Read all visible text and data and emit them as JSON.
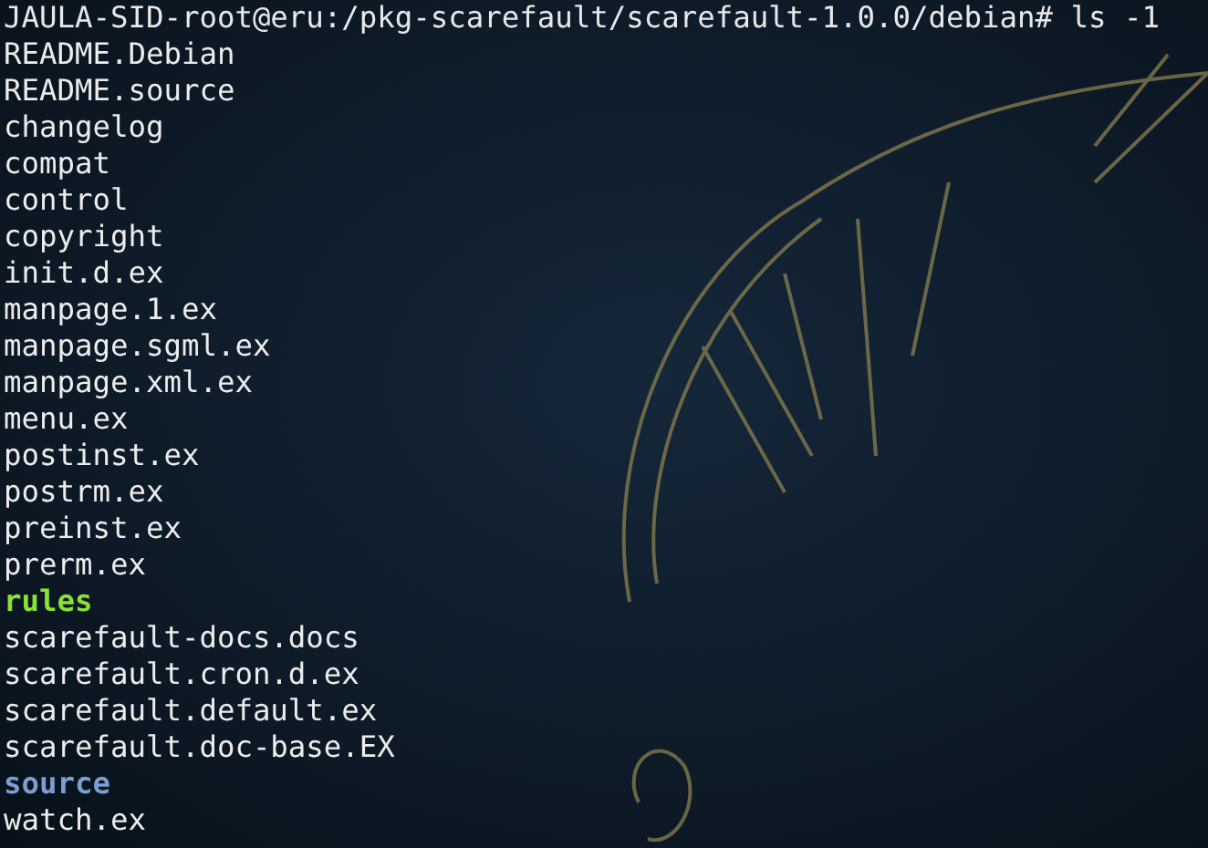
{
  "terminal": {
    "prompt": "JAULA-SID-root@eru:/pkg-scarefault/scarefault-1.0.0/debian#",
    "command": "ls -1",
    "entries": [
      {
        "name": "README.Debian",
        "kind": "file"
      },
      {
        "name": "README.source",
        "kind": "file"
      },
      {
        "name": "changelog",
        "kind": "file"
      },
      {
        "name": "compat",
        "kind": "file"
      },
      {
        "name": "control",
        "kind": "file"
      },
      {
        "name": "copyright",
        "kind": "file"
      },
      {
        "name": "init.d.ex",
        "kind": "file"
      },
      {
        "name": "manpage.1.ex",
        "kind": "file"
      },
      {
        "name": "manpage.sgml.ex",
        "kind": "file"
      },
      {
        "name": "manpage.xml.ex",
        "kind": "file"
      },
      {
        "name": "menu.ex",
        "kind": "file"
      },
      {
        "name": "postinst.ex",
        "kind": "file"
      },
      {
        "name": "postrm.ex",
        "kind": "file"
      },
      {
        "name": "preinst.ex",
        "kind": "file"
      },
      {
        "name": "prerm.ex",
        "kind": "file"
      },
      {
        "name": "rules",
        "kind": "executable"
      },
      {
        "name": "scarefault-docs.docs",
        "kind": "file"
      },
      {
        "name": "scarefault.cron.d.ex",
        "kind": "file"
      },
      {
        "name": "scarefault.default.ex",
        "kind": "file"
      },
      {
        "name": "scarefault.doc-base.EX",
        "kind": "file"
      },
      {
        "name": "source",
        "kind": "directory"
      },
      {
        "name": "watch.ex",
        "kind": "file"
      }
    ]
  }
}
